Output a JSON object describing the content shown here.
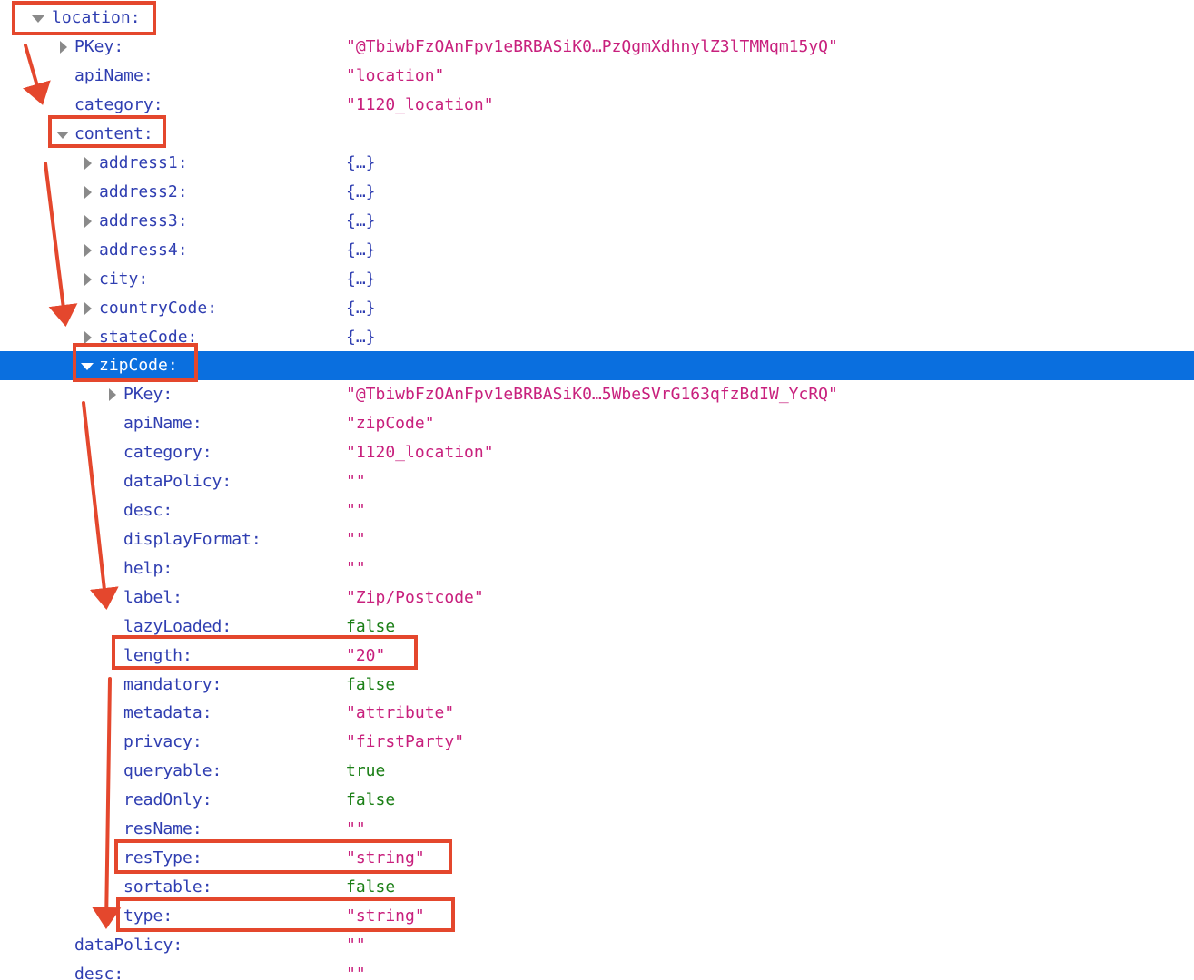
{
  "tree": {
    "location": {
      "key": "location:"
    },
    "location_pkey": {
      "key": "PKey:",
      "value": "\"@TbiwbFzOAnFpv1eBRBASiK0…PzQgmXdhnylZ3lTMMqm15yQ\""
    },
    "location_apiName": {
      "key": "apiName:",
      "value": "\"location\""
    },
    "location_category": {
      "key": "category:",
      "value": "\"1120_location\""
    },
    "content": {
      "key": "content:"
    },
    "address1": {
      "key": "address1:",
      "value": "{…}"
    },
    "address2": {
      "key": "address2:",
      "value": "{…}"
    },
    "address3": {
      "key": "address3:",
      "value": "{…}"
    },
    "address4": {
      "key": "address4:",
      "value": "{…}"
    },
    "city": {
      "key": "city:",
      "value": "{…}"
    },
    "countryCode": {
      "key": "countryCode:",
      "value": "{…}"
    },
    "stateCode": {
      "key": "stateCode:",
      "value": "{…}"
    },
    "zipCode": {
      "key": "zipCode:"
    },
    "zip_pkey": {
      "key": "PKey:",
      "value": "\"@TbiwbFzOAnFpv1eBRBASiK0…5WbeSVrG163qfzBdIW_YcRQ\""
    },
    "zip_apiName": {
      "key": "apiName:",
      "value": "\"zipCode\""
    },
    "zip_category": {
      "key": "category:",
      "value": "\"1120_location\""
    },
    "zip_dataPolicy": {
      "key": "dataPolicy:",
      "value": "\"\""
    },
    "zip_desc": {
      "key": "desc:",
      "value": "\"\""
    },
    "zip_displayFormat": {
      "key": "displayFormat:",
      "value": "\"\""
    },
    "zip_help": {
      "key": "help:",
      "value": "\"\""
    },
    "zip_label": {
      "key": "label:",
      "value": "\"Zip/Postcode\""
    },
    "zip_lazyLoaded": {
      "key": "lazyLoaded:",
      "value": "false"
    },
    "zip_length": {
      "key": "length:",
      "value": "\"20\""
    },
    "zip_mandatory": {
      "key": "mandatory:",
      "value": "false"
    },
    "zip_metadata": {
      "key": "metadata:",
      "value": "\"attribute\""
    },
    "zip_privacy": {
      "key": "privacy:",
      "value": "\"firstParty\""
    },
    "zip_queryable": {
      "key": "queryable:",
      "value": "true"
    },
    "zip_readOnly": {
      "key": "readOnly:",
      "value": "false"
    },
    "zip_resName": {
      "key": "resName:",
      "value": "\"\""
    },
    "zip_resType": {
      "key": "resType:",
      "value": "\"string\""
    },
    "zip_sortable": {
      "key": "sortable:",
      "value": "false"
    },
    "zip_type": {
      "key": "type:",
      "value": "\"string\""
    },
    "location_dataPolicy": {
      "key": "dataPolicy:",
      "value": "\"\""
    },
    "location_desc": {
      "key": "desc:",
      "value": "\"\""
    }
  },
  "colors": {
    "key": "#2f3eb1",
    "string": "#c8207d",
    "boolean": "#1b7f16",
    "selection": "#0a6fdf",
    "annotation": "#e4472d"
  }
}
